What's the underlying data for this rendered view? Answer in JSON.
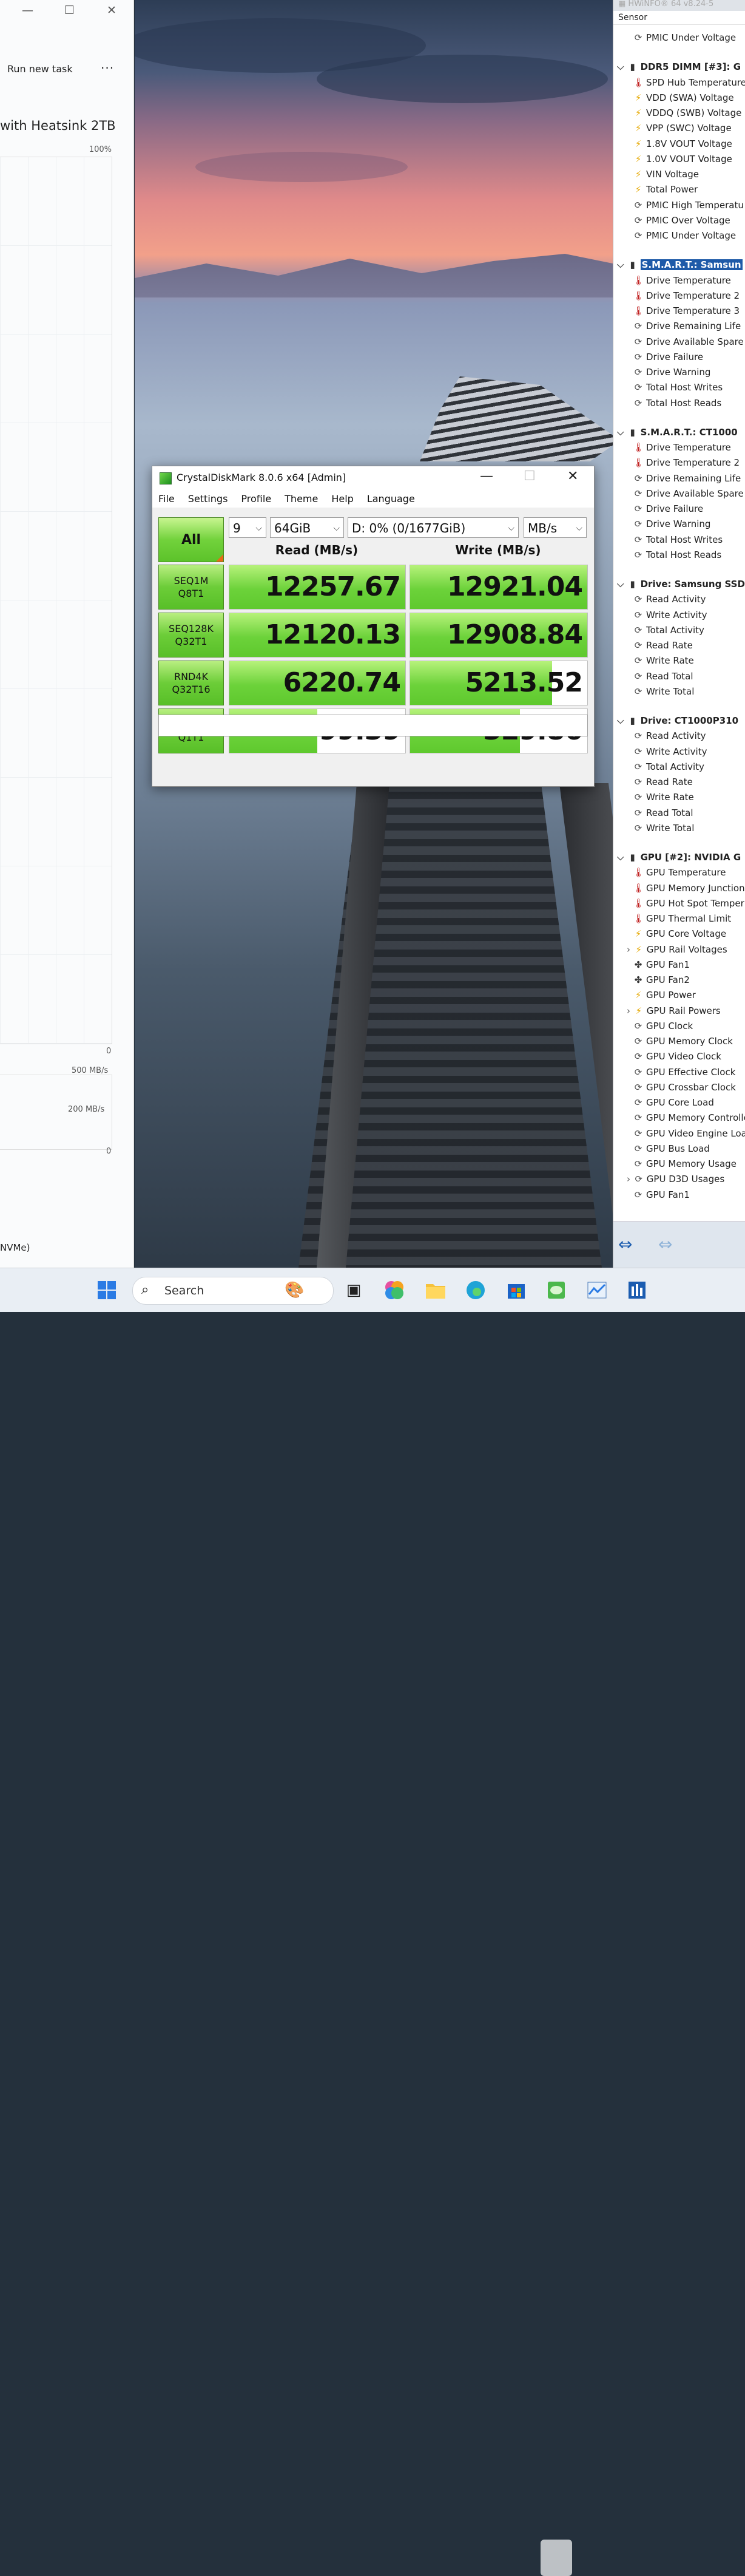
{
  "taskmgr": {
    "run_new_task": "Run new task",
    "more": "···",
    "heading": "with Heatsink 2TB",
    "percent_100": "100%",
    "graph_zero": "0",
    "lbl_500": "500 MB/s",
    "lbl_200": "200 MB/s",
    "graph2_zero": "0",
    "nvme": "NVMe)"
  },
  "hwinfo": {
    "title": "HWiNFO® 64 v8.24-5",
    "column": "Sensor",
    "rows": [
      {
        "t": "PMIC Under Voltage",
        "i": "clock"
      },
      {
        "t": "DDR5 DIMM [#3]: G",
        "i": "chip",
        "sec": true
      },
      {
        "t": "SPD Hub Temperature",
        "i": "temp"
      },
      {
        "t": "VDD (SWA) Voltage",
        "i": "volt"
      },
      {
        "t": "VDDQ (SWB) Voltage",
        "i": "volt"
      },
      {
        "t": "VPP (SWC) Voltage",
        "i": "volt"
      },
      {
        "t": "1.8V VOUT Voltage",
        "i": "volt"
      },
      {
        "t": "1.0V VOUT Voltage",
        "i": "volt"
      },
      {
        "t": "VIN Voltage",
        "i": "volt"
      },
      {
        "t": "Total Power",
        "i": "volt"
      },
      {
        "t": "PMIC High Temperatu",
        "i": "clock"
      },
      {
        "t": "PMIC Over Voltage",
        "i": "clock"
      },
      {
        "t": "PMIC Under Voltage",
        "i": "clock"
      },
      {
        "t": "S.M.A.R.T.: Samsun",
        "i": "chip",
        "sec": true,
        "sel": true
      },
      {
        "t": "Drive Temperature",
        "i": "temp"
      },
      {
        "t": "Drive Temperature 2",
        "i": "temp"
      },
      {
        "t": "Drive Temperature 3",
        "i": "temp"
      },
      {
        "t": "Drive Remaining Life",
        "i": "clock"
      },
      {
        "t": "Drive Available Spare",
        "i": "clock"
      },
      {
        "t": "Drive Failure",
        "i": "clock"
      },
      {
        "t": "Drive Warning",
        "i": "clock"
      },
      {
        "t": "Total Host Writes",
        "i": "clock"
      },
      {
        "t": "Total Host Reads",
        "i": "clock"
      },
      {
        "t": "S.M.A.R.T.: CT1000",
        "i": "chip",
        "sec": true
      },
      {
        "t": "Drive Temperature",
        "i": "temp"
      },
      {
        "t": "Drive Temperature 2",
        "i": "temp"
      },
      {
        "t": "Drive Remaining Life",
        "i": "clock"
      },
      {
        "t": "Drive Available Spare",
        "i": "clock"
      },
      {
        "t": "Drive Failure",
        "i": "clock"
      },
      {
        "t": "Drive Warning",
        "i": "clock"
      },
      {
        "t": "Total Host Writes",
        "i": "clock"
      },
      {
        "t": "Total Host Reads",
        "i": "clock"
      },
      {
        "t": "Drive: Samsung SSD",
        "i": "chip",
        "sec": true
      },
      {
        "t": "Read Activity",
        "i": "clock"
      },
      {
        "t": "Write Activity",
        "i": "clock"
      },
      {
        "t": "Total Activity",
        "i": "clock"
      },
      {
        "t": "Read Rate",
        "i": "clock"
      },
      {
        "t": "Write Rate",
        "i": "clock"
      },
      {
        "t": "Read Total",
        "i": "clock"
      },
      {
        "t": "Write Total",
        "i": "clock"
      },
      {
        "t": "Drive: CT1000P310",
        "i": "chip",
        "sec": true
      },
      {
        "t": "Read Activity",
        "i": "clock"
      },
      {
        "t": "Write Activity",
        "i": "clock"
      },
      {
        "t": "Total Activity",
        "i": "clock"
      },
      {
        "t": "Read Rate",
        "i": "clock"
      },
      {
        "t": "Write Rate",
        "i": "clock"
      },
      {
        "t": "Read Total",
        "i": "clock"
      },
      {
        "t": "Write Total",
        "i": "clock"
      },
      {
        "t": "GPU [#2]: NVIDIA G",
        "i": "chip",
        "sec": true
      },
      {
        "t": "GPU Temperature",
        "i": "temp"
      },
      {
        "t": "GPU Memory Junction",
        "i": "temp"
      },
      {
        "t": "GPU Hot Spot Temper",
        "i": "temp"
      },
      {
        "t": "GPU Thermal Limit",
        "i": "temp"
      },
      {
        "t": "GPU Core Voltage",
        "i": "volt"
      },
      {
        "t": "GPU Rail Voltages",
        "i": "volt",
        "sub": true
      },
      {
        "t": "GPU Fan1",
        "i": "fan"
      },
      {
        "t": "GPU Fan2",
        "i": "fan"
      },
      {
        "t": "GPU Power",
        "i": "volt"
      },
      {
        "t": "GPU Rail Powers",
        "i": "volt",
        "sub": true
      },
      {
        "t": "GPU Clock",
        "i": "clock"
      },
      {
        "t": "GPU Memory Clock",
        "i": "clock"
      },
      {
        "t": "GPU Video Clock",
        "i": "clock"
      },
      {
        "t": "GPU Effective Clock",
        "i": "clock"
      },
      {
        "t": "GPU Crossbar Clock",
        "i": "clock"
      },
      {
        "t": "GPU Core Load",
        "i": "clock"
      },
      {
        "t": "GPU Memory Controlle",
        "i": "clock"
      },
      {
        "t": "GPU Video Engine Loa",
        "i": "clock"
      },
      {
        "t": "GPU Bus Load",
        "i": "clock"
      },
      {
        "t": "GPU Memory Usage",
        "i": "clock"
      },
      {
        "t": "GPU D3D Usages",
        "i": "clock",
        "sub": true
      },
      {
        "t": "GPU Fan1",
        "i": "clock"
      }
    ]
  },
  "cdm": {
    "title": "CrystalDiskMark 8.0.6 x64 [Admin]",
    "menu": [
      "File",
      "Settings",
      "Profile",
      "Theme",
      "Help",
      "Language"
    ],
    "all_label": "All",
    "count": "9",
    "size": "64GiB",
    "drive": "D: 0% (0/1677GiB)",
    "unit": "MB/s",
    "read_header": "Read (MB/s)",
    "write_header": "Write (MB/s)",
    "tests": [
      {
        "l1": "SEQ1M",
        "l2": "Q8T1",
        "read": "12257.67",
        "write": "12921.04",
        "read_fill": 1.0,
        "write_fill": 1.0
      },
      {
        "l1": "SEQ128K",
        "l2": "Q32T1",
        "read": "12120.13",
        "write": "12908.84",
        "read_fill": 1.0,
        "write_fill": 1.0
      },
      {
        "l1": "RND4K",
        "l2": "Q32T16",
        "read": "6220.74",
        "write": "5213.52",
        "read_fill": 1.0,
        "write_fill": 0.8
      },
      {
        "l1": "RND4K",
        "l2": "Q1T1",
        "read": "99.39",
        "write": "329.86",
        "read_fill": 0.5,
        "write_fill": 0.62
      }
    ]
  },
  "taskbar": {
    "search_placeholder": "Search"
  }
}
